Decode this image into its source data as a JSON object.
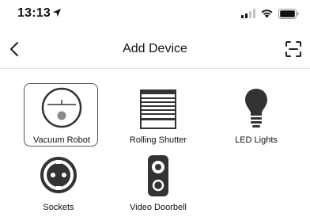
{
  "status_bar": {
    "time": "13:13",
    "location_icon": "location-arrow-icon",
    "signal_icon": "cellular-signal-icon",
    "wifi_icon": "wifi-icon",
    "battery_icon": "battery-icon"
  },
  "nav": {
    "title": "Add Device",
    "back_icon": "chevron-left-icon",
    "scan_icon": "scan-icon"
  },
  "devices": [
    {
      "label": "Vacuum Robot",
      "icon": "vacuum-robot-icon",
      "selected": true
    },
    {
      "label": "Rolling Shutter",
      "icon": "rolling-shutter-icon",
      "selected": false
    },
    {
      "label": "LED Lights",
      "icon": "light-bulb-icon",
      "selected": false
    },
    {
      "label": "Sockets",
      "icon": "socket-icon",
      "selected": false
    },
    {
      "label": "Video Doorbell",
      "icon": "video-doorbell-icon",
      "selected": false
    }
  ]
}
